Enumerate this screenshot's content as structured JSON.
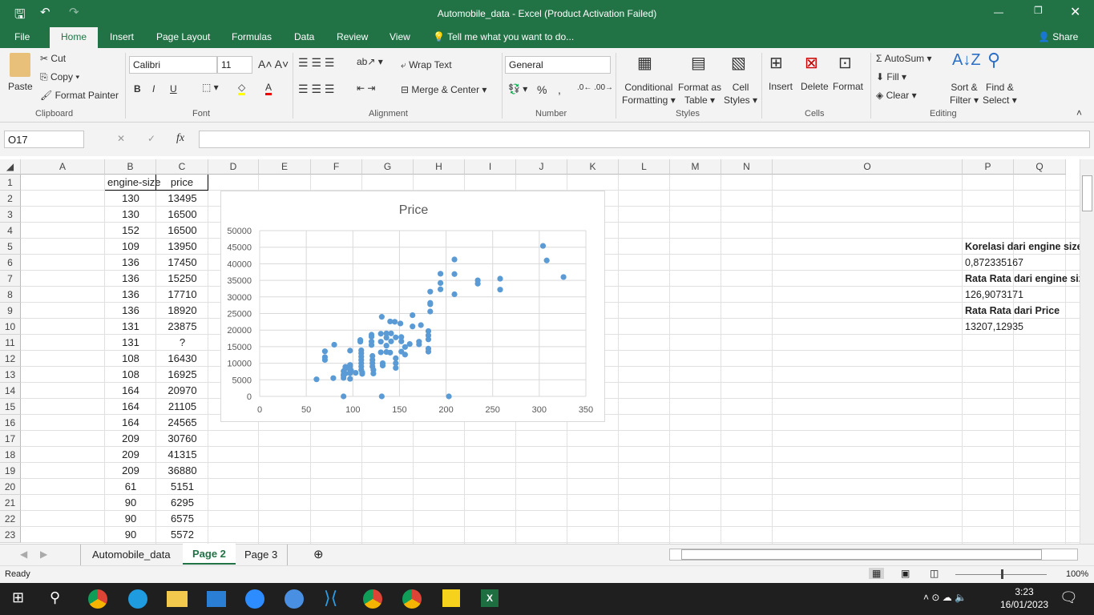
{
  "window": {
    "title": "Automobile_data - Excel (Product Activation Failed)",
    "share": "Share"
  },
  "menu_tabs": [
    "File",
    "Home",
    "Insert",
    "Page Layout",
    "Formulas",
    "Data",
    "Review",
    "View"
  ],
  "tell_me": "Tell me what you want to do...",
  "ribbon": {
    "clipboard": {
      "paste": "Paste",
      "cut": "Cut",
      "copy": "Copy",
      "format_painter": "Format Painter",
      "label": "Clipboard"
    },
    "font": {
      "name": "Calibri",
      "size": "11",
      "label": "Font",
      "bold": "B",
      "italic": "I",
      "underline": "U"
    },
    "alignment": {
      "wrap": "Wrap Text",
      "merge": "Merge & Center",
      "label": "Alignment"
    },
    "number": {
      "format": "General",
      "label": "Number",
      "percent": "%",
      "comma": ","
    },
    "styles": {
      "conditional": "Conditional",
      "conditional2": "Formatting",
      "format_as": "Format as",
      "format_as2": "Table",
      "cell": "Cell",
      "cell2": "Styles",
      "label": "Styles"
    },
    "cells": {
      "insert": "Insert",
      "delete": "Delete",
      "format": "Format",
      "label": "Cells"
    },
    "editing": {
      "autosum": "AutoSum",
      "fill": "Fill",
      "clear": "Clear",
      "sort": "Sort &",
      "sort2": "Filter",
      "find": "Find &",
      "find2": "Select",
      "label": "Editing"
    }
  },
  "formula_bar": {
    "name_box": "O17",
    "fx": "fx",
    "value": ""
  },
  "columns": [
    "A",
    "B",
    "C",
    "D",
    "E",
    "F",
    "G",
    "H",
    "I",
    "J",
    "K",
    "L",
    "M",
    "N",
    "O",
    "P",
    "Q"
  ],
  "rows": [
    1,
    2,
    3,
    4,
    5,
    6,
    7,
    8,
    9,
    10,
    11,
    12,
    13,
    14,
    15,
    16,
    17,
    18,
    19,
    20,
    21,
    22,
    23
  ],
  "table": {
    "headers": [
      "engine-size",
      "price"
    ],
    "data": [
      [
        "130",
        "13495"
      ],
      [
        "130",
        "16500"
      ],
      [
        "152",
        "16500"
      ],
      [
        "109",
        "13950"
      ],
      [
        "136",
        "17450"
      ],
      [
        "136",
        "15250"
      ],
      [
        "136",
        "17710"
      ],
      [
        "136",
        "18920"
      ],
      [
        "131",
        "23875"
      ],
      [
        "131",
        "?"
      ],
      [
        "108",
        "16430"
      ],
      [
        "108",
        "16925"
      ],
      [
        "164",
        "20970"
      ],
      [
        "164",
        "21105"
      ],
      [
        "164",
        "24565"
      ],
      [
        "209",
        "30760"
      ],
      [
        "209",
        "41315"
      ],
      [
        "209",
        "36880"
      ],
      [
        "61",
        "5151"
      ],
      [
        "90",
        "6295"
      ],
      [
        "90",
        "6575"
      ],
      [
        "90",
        "5572"
      ]
    ]
  },
  "notes": [
    {
      "row": 5,
      "text": "Korelasi dari engine size dan price",
      "bold": true
    },
    {
      "row": 6,
      "text": "0,872335167",
      "bold": false
    },
    {
      "row": 7,
      "text": "Rata Rata dari engine size",
      "bold": true
    },
    {
      "row": 8,
      "text": "126,9073171",
      "bold": false
    },
    {
      "row": 9,
      "text": "Rata Rata dari Price",
      "bold": true
    },
    {
      "row": 10,
      "text": "13207,12935",
      "bold": false
    }
  ],
  "chart_data": {
    "type": "scatter",
    "title": "Price",
    "xlim": [
      0,
      350
    ],
    "ylim": [
      0,
      50000
    ],
    "xticks": [
      "0",
      "50",
      "100",
      "150",
      "200",
      "250",
      "300",
      "350"
    ],
    "yticks": [
      "0",
      "5000",
      "10000",
      "15000",
      "20000",
      "25000",
      "30000",
      "35000",
      "40000",
      "45000",
      "50000"
    ],
    "grid": true,
    "color": "#5b9bd5",
    "points": [
      [
        61,
        5151
      ],
      [
        70,
        13600
      ],
      [
        70,
        11850
      ],
      [
        70,
        11000
      ],
      [
        80,
        15600
      ],
      [
        79,
        5500
      ],
      [
        90,
        0
      ],
      [
        131,
        0
      ],
      [
        203,
        0
      ],
      [
        90,
        5572
      ],
      [
        90,
        6295
      ],
      [
        90,
        6575
      ],
      [
        90,
        7600
      ],
      [
        92,
        8500
      ],
      [
        92,
        8900
      ],
      [
        92,
        6900
      ],
      [
        97,
        13800
      ],
      [
        97,
        5300
      ],
      [
        97,
        7000
      ],
      [
        97,
        8000
      ],
      [
        97,
        9000
      ],
      [
        97,
        9500
      ],
      [
        98,
        7800
      ],
      [
        103,
        7100
      ],
      [
        108,
        17000
      ],
      [
        108,
        16500
      ],
      [
        109,
        13900
      ],
      [
        109,
        13000
      ],
      [
        109,
        12000
      ],
      [
        109,
        11000
      ],
      [
        109,
        10000
      ],
      [
        109,
        9000
      ],
      [
        109,
        8000
      ],
      [
        110,
        7200
      ],
      [
        110,
        6800
      ],
      [
        120,
        18600
      ],
      [
        120,
        18000
      ],
      [
        120,
        16500
      ],
      [
        120,
        15500
      ],
      [
        121,
        12200
      ],
      [
        121,
        11000
      ],
      [
        121,
        10000
      ],
      [
        121,
        9000
      ],
      [
        122,
        8000
      ],
      [
        122,
        6900
      ],
      [
        130,
        18900
      ],
      [
        130,
        16500
      ],
      [
        131,
        24000
      ],
      [
        130,
        13300
      ],
      [
        132,
        10000
      ],
      [
        132,
        9300
      ],
      [
        136,
        19000
      ],
      [
        136,
        17700
      ],
      [
        136,
        15300
      ],
      [
        136,
        13400
      ],
      [
        140,
        22600
      ],
      [
        141,
        19000
      ],
      [
        141,
        16600
      ],
      [
        140,
        13200
      ],
      [
        145,
        22500
      ],
      [
        146,
        17800
      ],
      [
        146,
        11500
      ],
      [
        146,
        10000
      ],
      [
        146,
        8600
      ],
      [
        151,
        22000
      ],
      [
        152,
        17900
      ],
      [
        152,
        16600
      ],
      [
        152,
        13500
      ],
      [
        156,
        14900
      ],
      [
        156,
        12600
      ],
      [
        161,
        15800
      ],
      [
        164,
        24500
      ],
      [
        164,
        21100
      ],
      [
        171,
        16500
      ],
      [
        171,
        15700
      ],
      [
        173,
        21500
      ],
      [
        181,
        19700
      ],
      [
        181,
        18400
      ],
      [
        181,
        17200
      ],
      [
        181,
        14400
      ],
      [
        181,
        13500
      ],
      [
        183,
        31600
      ],
      [
        183,
        28200
      ],
      [
        183,
        27800
      ],
      [
        183,
        25600
      ],
      [
        194,
        37000
      ],
      [
        194,
        34200
      ],
      [
        194,
        32300
      ],
      [
        209,
        41300
      ],
      [
        209,
        36900
      ],
      [
        209,
        30800
      ],
      [
        234,
        35000
      ],
      [
        234,
        34000
      ],
      [
        258,
        35500
      ],
      [
        258,
        32200
      ],
      [
        304,
        45400
      ],
      [
        308,
        41000
      ],
      [
        326,
        36000
      ]
    ]
  },
  "sheets": [
    "Automobile_data",
    "Page 2",
    "Page 3"
  ],
  "active_sheet": "Page 2",
  "status": {
    "ready": "Ready",
    "zoom": "100%"
  },
  "taskbar": {
    "time": "3:23",
    "date": "16/01/2023"
  }
}
